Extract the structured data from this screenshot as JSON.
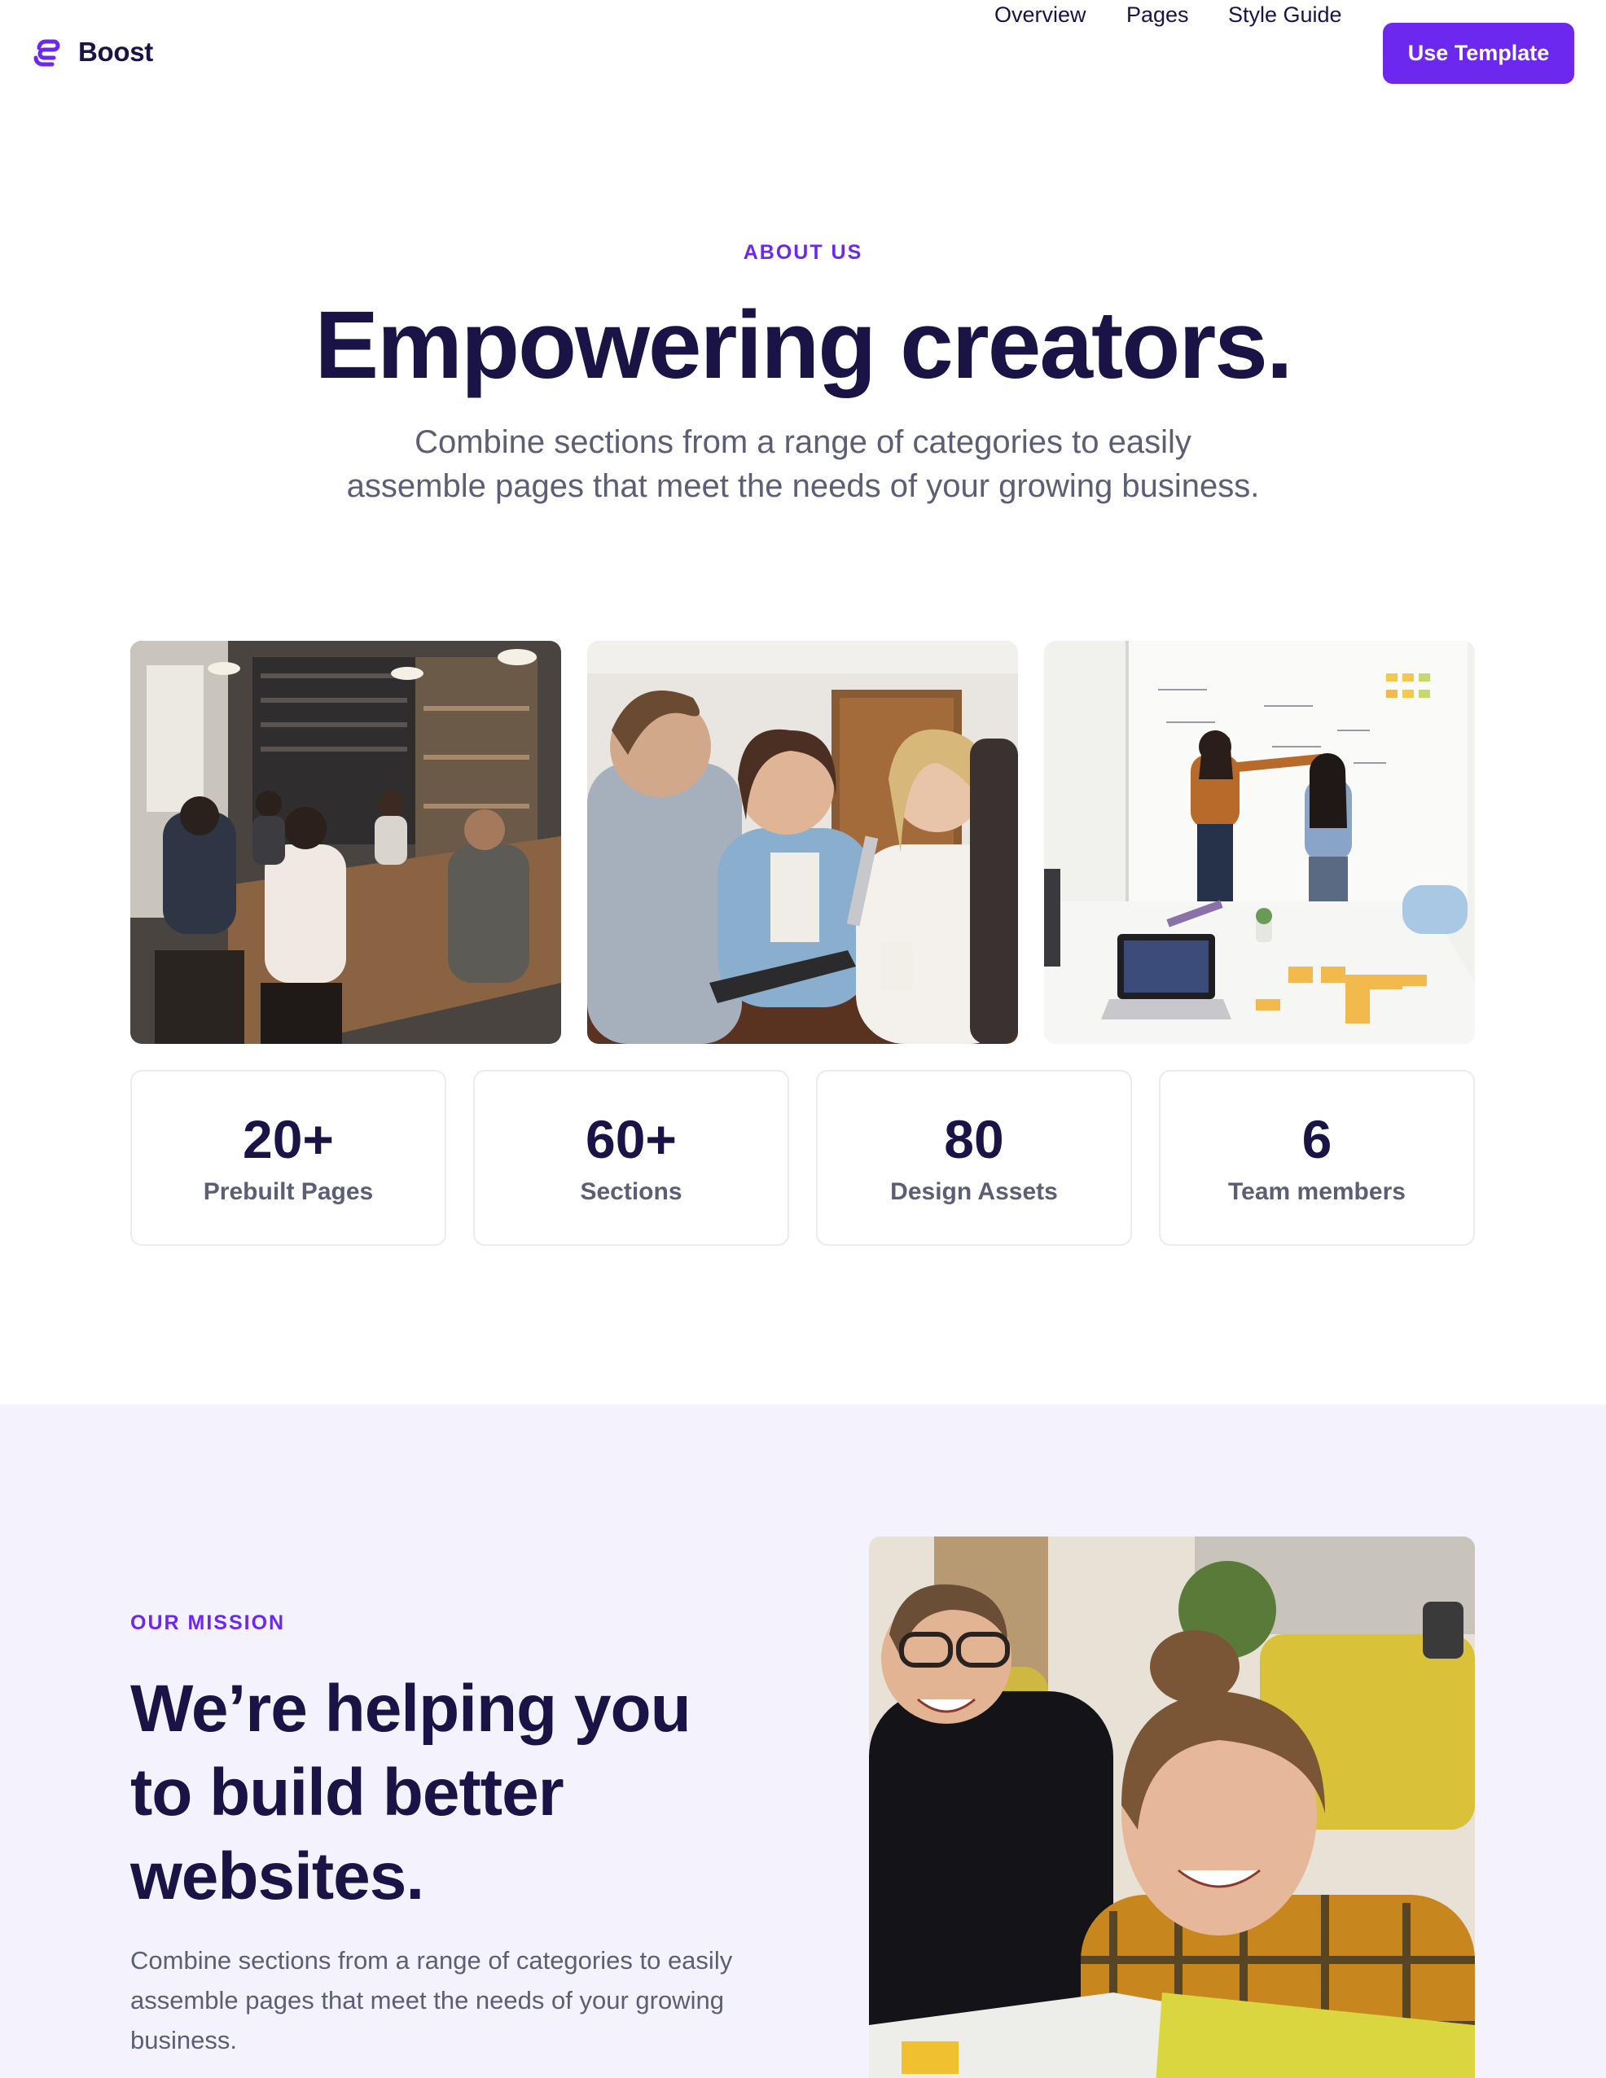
{
  "nav": {
    "brand": "Boost",
    "links": [
      "Overview",
      "Pages",
      "Style Guide"
    ],
    "cta": "Use Template"
  },
  "hero": {
    "eyebrow": "ABOUT US",
    "title": "Empowering creators.",
    "subtitle_line1": "Combine sections from a range of categories to easily",
    "subtitle_line2": "assemble pages that meet the needs of your growing business."
  },
  "stats": [
    {
      "value": "20+",
      "label": "Prebuilt Pages"
    },
    {
      "value": "60+",
      "label": "Sections"
    },
    {
      "value": "80",
      "label": "Design Assets"
    },
    {
      "value": "6",
      "label": "Team members"
    }
  ],
  "mission": {
    "eyebrow": "OUR MISSION",
    "title_line1": "We’re helping you",
    "title_line2": "to build better",
    "title_line3": "websites.",
    "text_line1": "Combine sections from a range of categories to easily",
    "text_line2": "assemble pages that meet the needs of your growing",
    "text_line3": "business."
  },
  "colors": {
    "accent": "#6d28f0",
    "heading": "#1a1446",
    "body": "#5b5e74",
    "mission_bg": "#f4f3fd"
  },
  "icons": {
    "brand": "boost-logo-icon"
  }
}
